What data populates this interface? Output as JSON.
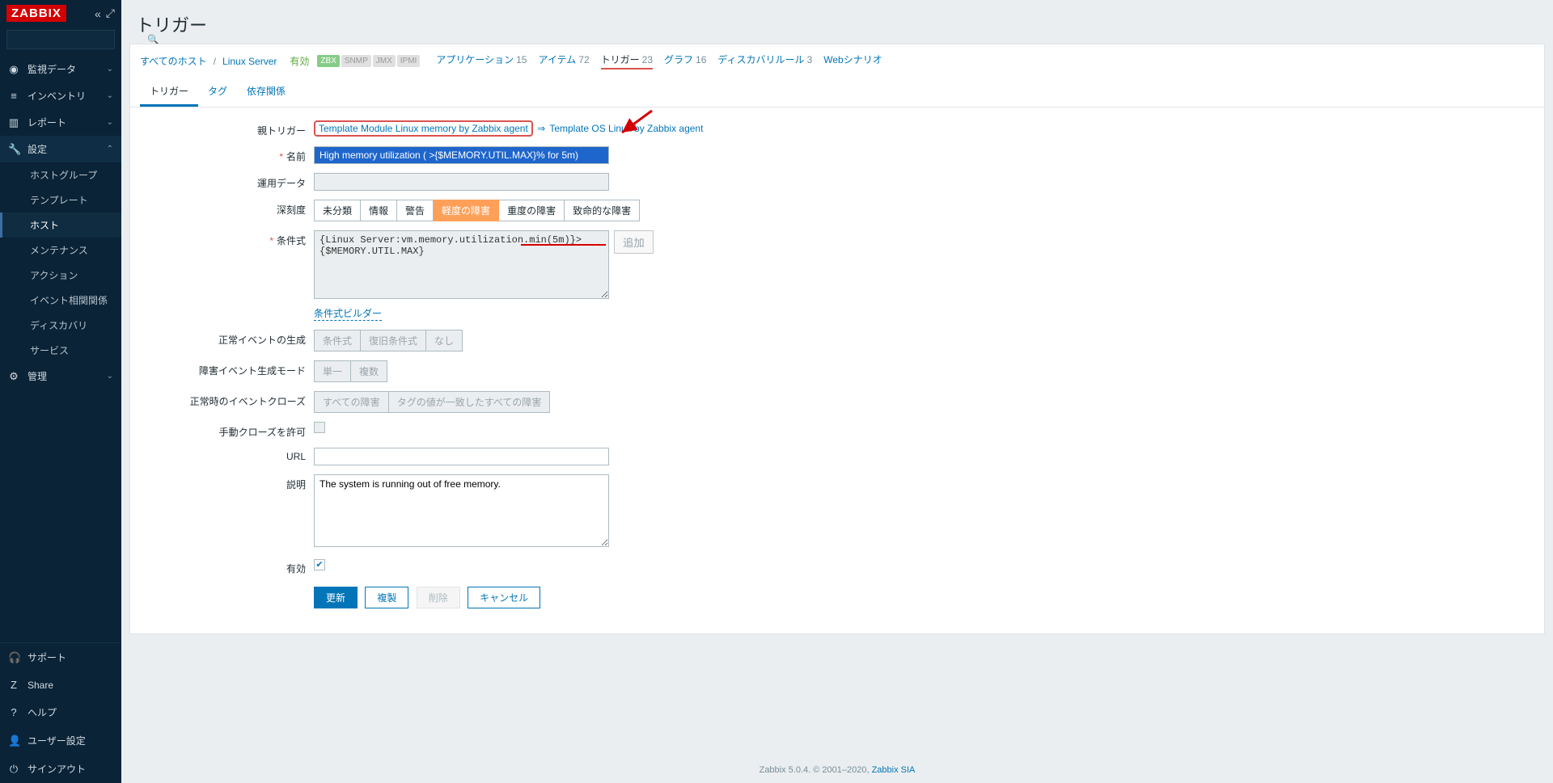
{
  "app": {
    "logo": "ZABBIX"
  },
  "search": {
    "placeholder": ""
  },
  "nav": {
    "monitoring": "監視データ",
    "inventory": "インベントリ",
    "reports": "レポート",
    "config": "設定",
    "admin": "管理"
  },
  "config_sub": {
    "hostgroups": "ホストグループ",
    "templates": "テンプレート",
    "hosts": "ホスト",
    "maintenance": "メンテナンス",
    "actions": "アクション",
    "eventcorrelation": "イベント相関関係",
    "discovery": "ディスカバリ",
    "services": "サービス"
  },
  "bottom": {
    "support": "サポート",
    "share": "Share",
    "help": "ヘルプ",
    "usersettings": "ユーザー設定",
    "signout": "サインアウト"
  },
  "page_title": "トリガー",
  "breadcrumb": {
    "allhosts": "すべてのホスト",
    "host": "Linux Server",
    "enabled": "有効"
  },
  "hostlinks": {
    "applications": {
      "label": "アプリケーション",
      "count": "15"
    },
    "items": {
      "label": "アイテム",
      "count": "72"
    },
    "triggers": {
      "label": "トリガー",
      "count": "23"
    },
    "graphs": {
      "label": "グラフ",
      "count": "16"
    },
    "discovery": {
      "label": "ディスカバリルール",
      "count": "3"
    },
    "web": {
      "label": "Webシナリオ",
      "count": ""
    }
  },
  "tabs": {
    "trigger": "トリガー",
    "tags": "タグ",
    "deps": "依存関係"
  },
  "labels": {
    "parent_triggers": "親トリガー",
    "name": "名前",
    "opdata": "運用データ",
    "severity": "深刻度",
    "expression": "条件式",
    "ok_event_gen": "正常イベントの生成",
    "problem_event_gen": "障害イベント生成モード",
    "ok_event_close": "正常時のイベントクローズ",
    "manual_close": "手動クローズを許可",
    "url": "URL",
    "description": "説明",
    "enabled": "有効"
  },
  "values": {
    "parent1": "Template Module Linux memory by Zabbix agent",
    "parent2": "Template OS Linux by Zabbix agent",
    "name": "High memory utilization ( >{$MEMORY.UTIL.MAX}% for 5m)",
    "opdata": "",
    "expression": "{Linux Server:vm.memory.utilization.min(5m)}>{$MEMORY.UTIL.MAX}",
    "url": "",
    "description": "The system is running out of free memory."
  },
  "severity": {
    "not_classified": "未分類",
    "information": "情報",
    "warning": "警告",
    "average": "軽度の障害",
    "high": "重度の障害",
    "disaster": "致命的な障害"
  },
  "ok_event": {
    "expression": "条件式",
    "recovery": "復旧条件式",
    "none": "なし"
  },
  "problem_mode": {
    "single": "単一",
    "multiple": "複数"
  },
  "ok_close": {
    "all": "すべての障害",
    "tag": "タグの値が一致したすべての障害"
  },
  "buttons": {
    "add": "追加",
    "expr_builder": "条件式ビルダー",
    "update": "更新",
    "clone": "複製",
    "delete": "削除",
    "cancel": "キャンセル"
  },
  "badges": {
    "zbx": "ZBX",
    "snmp": "SNMP",
    "jmx": "JMX",
    "ipmi": "IPMI"
  },
  "footer": {
    "text": "Zabbix 5.0.4. © 2001–2020, ",
    "link": "Zabbix SIA"
  },
  "arrow_sep": "⇒"
}
